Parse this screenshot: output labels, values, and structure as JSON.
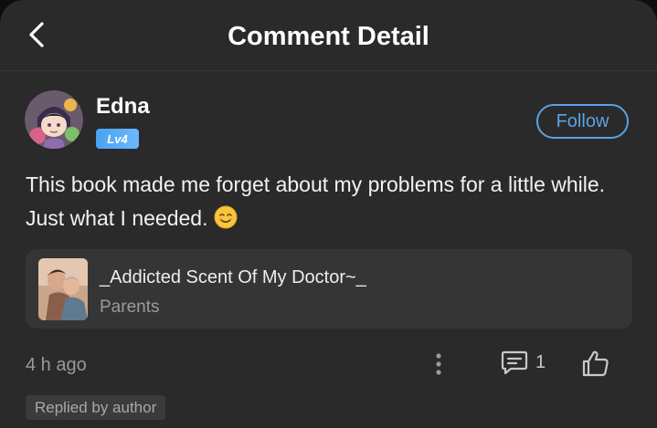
{
  "header": {
    "title": "Comment Detail",
    "back_icon": "chevron-left-icon"
  },
  "comment": {
    "author": "Edna",
    "level": "Lv4",
    "follow_label": "Follow",
    "text": "This book made me forget about my problems for a little while. Just what I needed.",
    "emoji": "smiling-face-emoji",
    "time_ago": "4 h ago",
    "reply_count": "1",
    "replied_badge": "Replied by author"
  },
  "book": {
    "title": "_Addicted Scent Of My Doctor~_",
    "genre": "Parents"
  },
  "colors": {
    "background": "#2a2a2a",
    "accent": "#5aa2e6",
    "level_badge": "#4aa3f0",
    "card": "#353535"
  }
}
